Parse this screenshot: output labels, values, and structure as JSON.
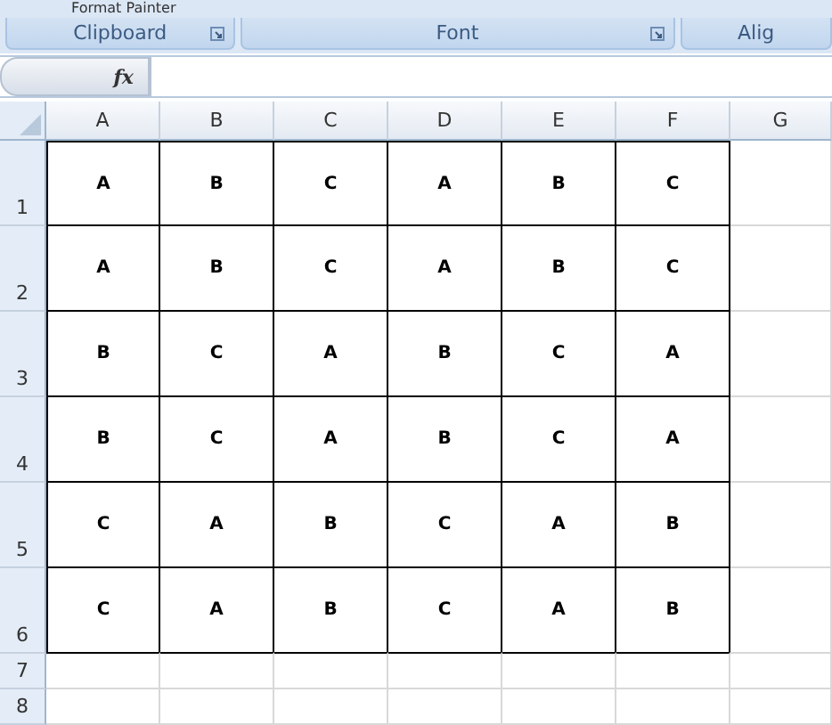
{
  "ribbon": {
    "top_button": "Format Painter",
    "groups": [
      {
        "label": "Clipboard",
        "launcher": true
      },
      {
        "label": "Font",
        "launcher": true
      },
      {
        "label": "Alig",
        "launcher": false
      }
    ]
  },
  "formula_bar": {
    "fx": "fx"
  },
  "sheet": {
    "columns": [
      "A",
      "B",
      "C",
      "D",
      "E",
      "F",
      "G"
    ],
    "rows": [
      {
        "number": "1",
        "cells": [
          "A",
          "B",
          "C",
          "A",
          "B",
          "C"
        ]
      },
      {
        "number": "2",
        "cells": [
          "A",
          "B",
          "C",
          "A",
          "B",
          "C"
        ]
      },
      {
        "number": "3",
        "cells": [
          "B",
          "C",
          "A",
          "B",
          "C",
          "A"
        ]
      },
      {
        "number": "4",
        "cells": [
          "B",
          "C",
          "A",
          "B",
          "C",
          "A"
        ]
      },
      {
        "number": "5",
        "cells": [
          "C",
          "A",
          "B",
          "C",
          "A",
          "B"
        ]
      },
      {
        "number": "6",
        "cells": [
          "C",
          "A",
          "B",
          "C",
          "A",
          "B"
        ]
      },
      {
        "number": "7",
        "cells": []
      },
      {
        "number": "8",
        "cells": []
      }
    ]
  }
}
